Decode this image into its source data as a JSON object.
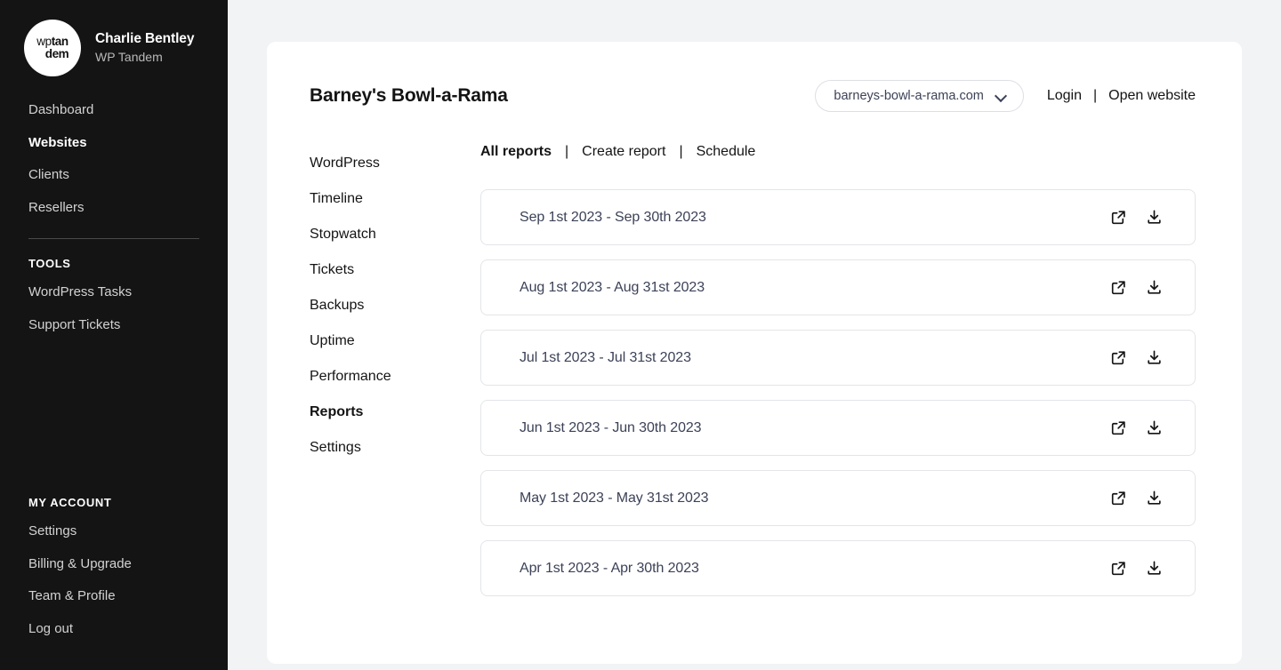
{
  "sidebar": {
    "logo": {
      "line1_light": "wp",
      "line1_bold": "tan",
      "line2": "dem",
      "icon": "wptandem-logo"
    },
    "user_name": "Charlie Bentley",
    "user_org": "WP Tandem",
    "primary_items": [
      {
        "label": "Dashboard",
        "active": false
      },
      {
        "label": "Websites",
        "active": true
      },
      {
        "label": "Clients",
        "active": false
      },
      {
        "label": "Resellers",
        "active": false
      }
    ],
    "tools_heading": "TOOLS",
    "tools_items": [
      {
        "label": "WordPress Tasks"
      },
      {
        "label": "Support Tickets"
      }
    ],
    "account_heading": "MY ACCOUNT",
    "account_items": [
      {
        "label": "Settings"
      },
      {
        "label": "Billing & Upgrade"
      },
      {
        "label": "Team & Profile"
      },
      {
        "label": "Log out"
      }
    ]
  },
  "header": {
    "title": "Barney's Bowl-a-Rama",
    "site_select_value": "barneys-bowl-a-rama.com",
    "login_label": "Login",
    "separator": "|",
    "open_website_label": "Open website"
  },
  "site_nav": [
    {
      "label": "WordPress",
      "active": false
    },
    {
      "label": "Timeline",
      "active": false
    },
    {
      "label": "Stopwatch",
      "active": false
    },
    {
      "label": "Tickets",
      "active": false
    },
    {
      "label": "Backups",
      "active": false
    },
    {
      "label": "Uptime",
      "active": false
    },
    {
      "label": "Performance",
      "active": false
    },
    {
      "label": "Reports",
      "active": true
    },
    {
      "label": "Settings",
      "active": false
    }
  ],
  "tabs": {
    "separator": "|",
    "items": [
      {
        "label": "All reports",
        "active": true
      },
      {
        "label": "Create report",
        "active": false
      },
      {
        "label": "Schedule",
        "active": false
      }
    ]
  },
  "reports": [
    {
      "range": "Sep 1st 2023 - Sep 30th 2023"
    },
    {
      "range": "Aug 1st 2023 - Aug 31st 2023"
    },
    {
      "range": "Jul 1st 2023 - Jul 31st 2023"
    },
    {
      "range": "Jun 1st 2023 - Jun 30th 2023"
    },
    {
      "range": "May 1st 2023 - May 31st 2023"
    },
    {
      "range": "Apr 1st 2023 - Apr 30th 2023"
    }
  ],
  "row_actions": {
    "open_icon": "external-link-icon",
    "download_icon": "download-icon"
  },
  "colors": {
    "sidebar_bg": "#141414",
    "page_bg": "#f2f3f5",
    "card_bg": "#ffffff",
    "text_dark": "#141414",
    "text_slate": "#3c4257",
    "border": "#e3e5e9"
  }
}
